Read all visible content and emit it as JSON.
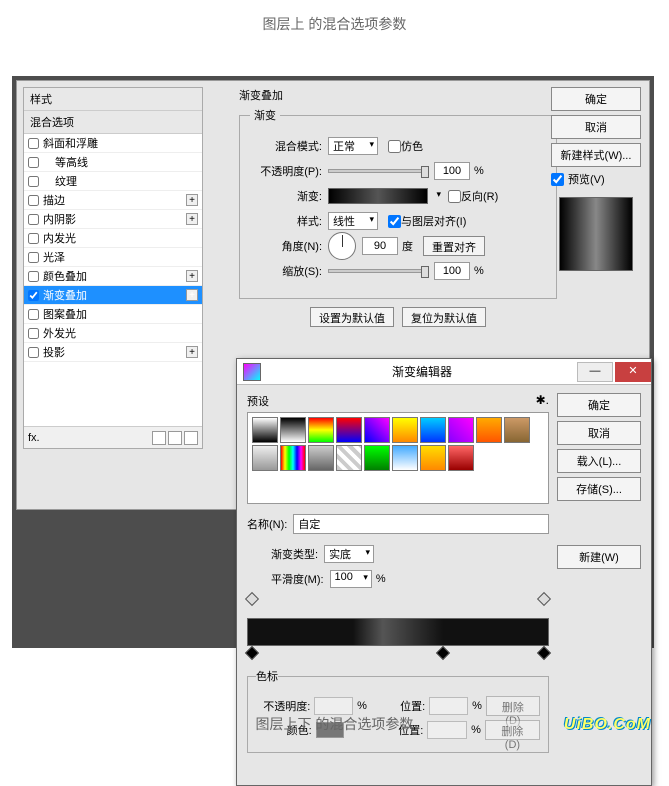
{
  "captions": {
    "top": "图层上   的混合选项参数",
    "bottom": "图层上下   的混合选项参数",
    "watermark": "UiBO.CoM"
  },
  "stylePanel": {
    "header": "样式",
    "blendOptions": "混合选项",
    "items": [
      {
        "label": "斜面和浮雕",
        "checked": false,
        "plus": false
      },
      {
        "label": "等高线",
        "checked": false,
        "plus": false,
        "indent": true
      },
      {
        "label": "纹理",
        "checked": false,
        "plus": false,
        "indent": true
      },
      {
        "label": "描边",
        "checked": false,
        "plus": true
      },
      {
        "label": "内阴影",
        "checked": false,
        "plus": true
      },
      {
        "label": "内发光",
        "checked": false,
        "plus": false
      },
      {
        "label": "光泽",
        "checked": false,
        "plus": false
      },
      {
        "label": "颜色叠加",
        "checked": false,
        "plus": true
      },
      {
        "label": "渐变叠加",
        "checked": true,
        "plus": true,
        "selected": true
      },
      {
        "label": "图案叠加",
        "checked": false,
        "plus": false
      },
      {
        "label": "外发光",
        "checked": false,
        "plus": false
      },
      {
        "label": "投影",
        "checked": false,
        "plus": true
      }
    ],
    "fx": "fx."
  },
  "gradOverlay": {
    "title": "渐变叠加",
    "sub": "渐变",
    "blendMode": {
      "label": "混合模式:",
      "value": "正常"
    },
    "dither": "仿色",
    "opacity": {
      "label": "不透明度(P):",
      "value": "100",
      "unit": "%"
    },
    "gradient": {
      "label": "渐变:"
    },
    "reverse": "反向(R)",
    "style": {
      "label": "样式:",
      "value": "线性"
    },
    "align": "与图层对齐(I)",
    "angle": {
      "label": "角度(N):",
      "value": "90",
      "unit": "度"
    },
    "resetAlign": "重置对齐",
    "scale": {
      "label": "缩放(S):",
      "value": "100",
      "unit": "%"
    },
    "makeDefault": "设置为默认值",
    "resetDefault": "复位为默认值"
  },
  "rightCol": {
    "ok": "确定",
    "cancel": "取消",
    "newStyle": "新建样式(W)...",
    "preview": "预览(V)"
  },
  "gradEditor": {
    "title": "渐变编辑器",
    "presets": "预设",
    "ok": "确定",
    "cancel": "取消",
    "load": "载入(L)...",
    "save": "存储(S)...",
    "nameLabel": "名称(N):",
    "nameValue": "自定",
    "new": "新建(W)",
    "typeLabel": "渐变类型:",
    "typeValue": "实底",
    "smoothLabel": "平滑度(M):",
    "smoothValue": "100",
    "smoothUnit": "%",
    "stopsTitle": "色标",
    "opacityLabel": "不透明度:",
    "opacityUnit": "%",
    "positionLabel": "位置:",
    "positionUnit": "%",
    "delete": "删除(D)",
    "colorLabel": "颜色:"
  }
}
